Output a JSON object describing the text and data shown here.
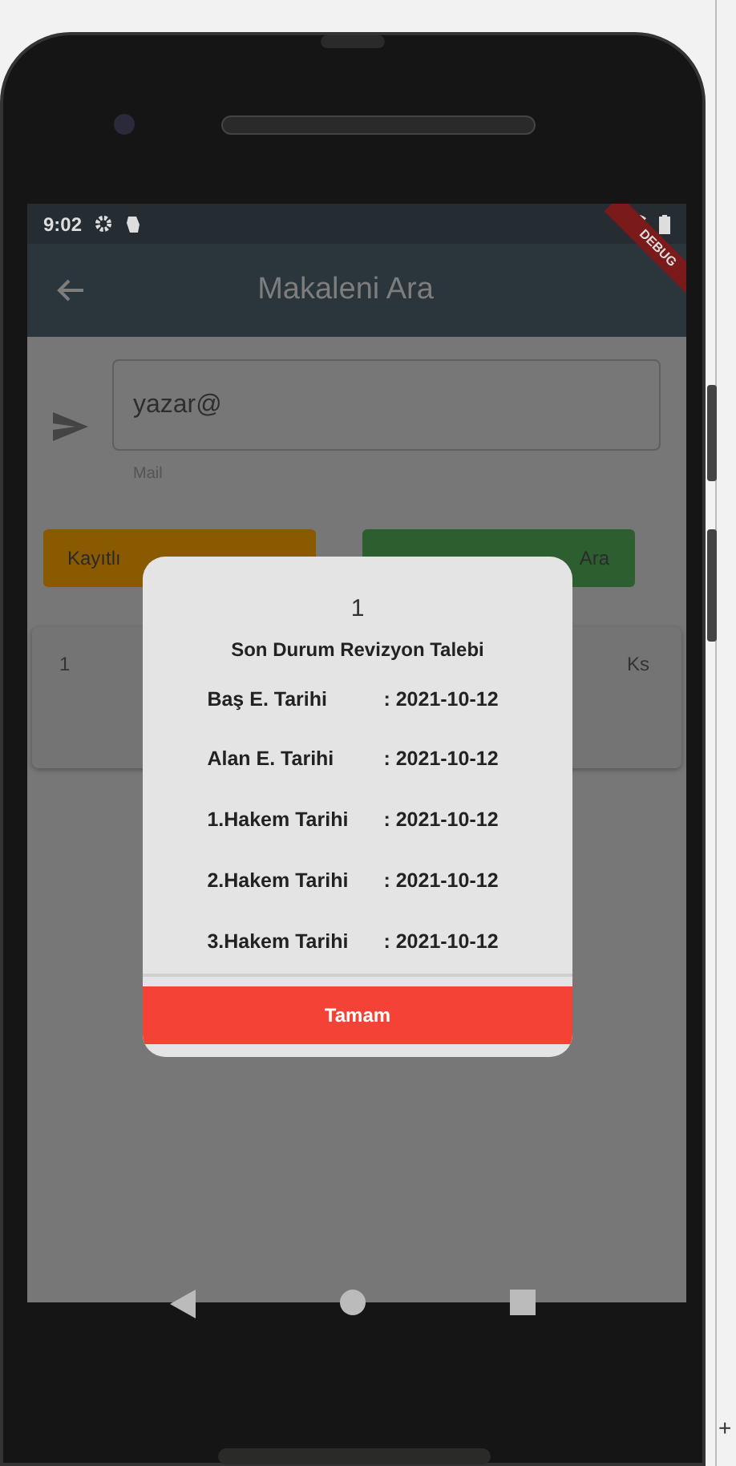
{
  "status_bar": {
    "time": "9:02"
  },
  "app_bar": {
    "title": "Makaleni Ara",
    "debug_banner": "DEBUG"
  },
  "mail_field": {
    "value": "yazar@",
    "helper": "Mail"
  },
  "buttons": [
    {
      "label": "Kayıtlı",
      "kind": "orange"
    },
    {
      "label": "Ara",
      "kind": "green"
    }
  ],
  "result_row": {
    "column_1": "1",
    "column_2": "Ks"
  },
  "dialog": {
    "title": "1",
    "subtitle": "Son Durum Revizyon Talebi",
    "rows": [
      {
        "label": "Baş E. Tarihi",
        "value": ": 2021-10-12"
      },
      {
        "label": "Alan E. Tarihi",
        "value": ": 2021-10-12"
      },
      {
        "label": "1.Hakem Tarihi",
        "value": ": 2021-10-12"
      },
      {
        "label": "2.Hakem Tarihi",
        "value": ": 2021-10-12"
      },
      {
        "label": "3.Hakem Tarihi",
        "value": ": 2021-10-12"
      }
    ],
    "button": "Tamam"
  },
  "corner_mark": "+"
}
